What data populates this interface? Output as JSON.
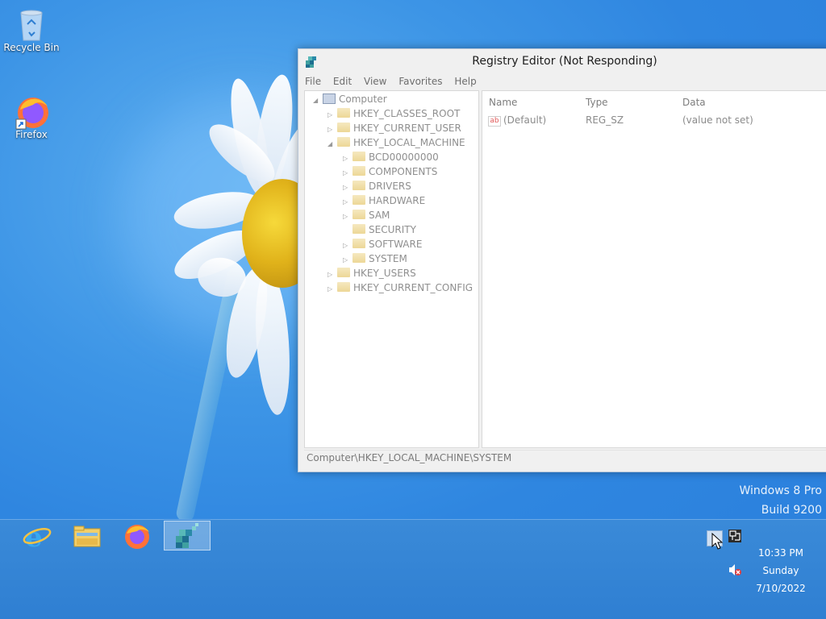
{
  "desktop": {
    "icons": [
      {
        "label": "Recycle Bin",
        "icon": "recycle-bin-icon"
      },
      {
        "label": "Firefox",
        "icon": "firefox-icon"
      }
    ],
    "watermark": {
      "line1": "Windows 8 Pro",
      "line2": "Build 9200"
    }
  },
  "registry_editor": {
    "title": "Registry Editor (Not Responding)",
    "menu": [
      "File",
      "Edit",
      "View",
      "Favorites",
      "Help"
    ],
    "tree": {
      "root": "Computer",
      "hives": [
        "HKEY_CLASSES_ROOT",
        "HKEY_CURRENT_USER",
        "HKEY_LOCAL_MACHINE"
      ],
      "hklm_children": [
        "BCD00000000",
        "COMPONENTS",
        "DRIVERS",
        "HARDWARE",
        "SAM",
        "SECURITY",
        "SOFTWARE",
        "SYSTEM"
      ],
      "other_hives": [
        "HKEY_USERS",
        "HKEY_CURRENT_CONFIG"
      ]
    },
    "columns": {
      "name": "Name",
      "type": "Type",
      "data": "Data"
    },
    "values": [
      {
        "name": "(Default)",
        "type": "REG_SZ",
        "data": "(value not set)"
      }
    ],
    "status_path": "Computer\\HKEY_LOCAL_MACHINE\\SYSTEM"
  },
  "taskbar": {
    "pinned": [
      "internet-explorer-icon",
      "file-explorer-icon",
      "firefox-icon",
      "registry-editor-icon"
    ],
    "active_index": 3
  },
  "tray": {
    "time": "10:33 PM",
    "day": "Sunday",
    "date": "7/10/2022",
    "icons": [
      "action-center-flag-icon",
      "network-icon",
      "speaker-muted-icon"
    ]
  },
  "colors": {
    "desktop_blue": "#2f86e0",
    "taskbar": "#3485d5",
    "window_bg": "#f0f0f0"
  }
}
